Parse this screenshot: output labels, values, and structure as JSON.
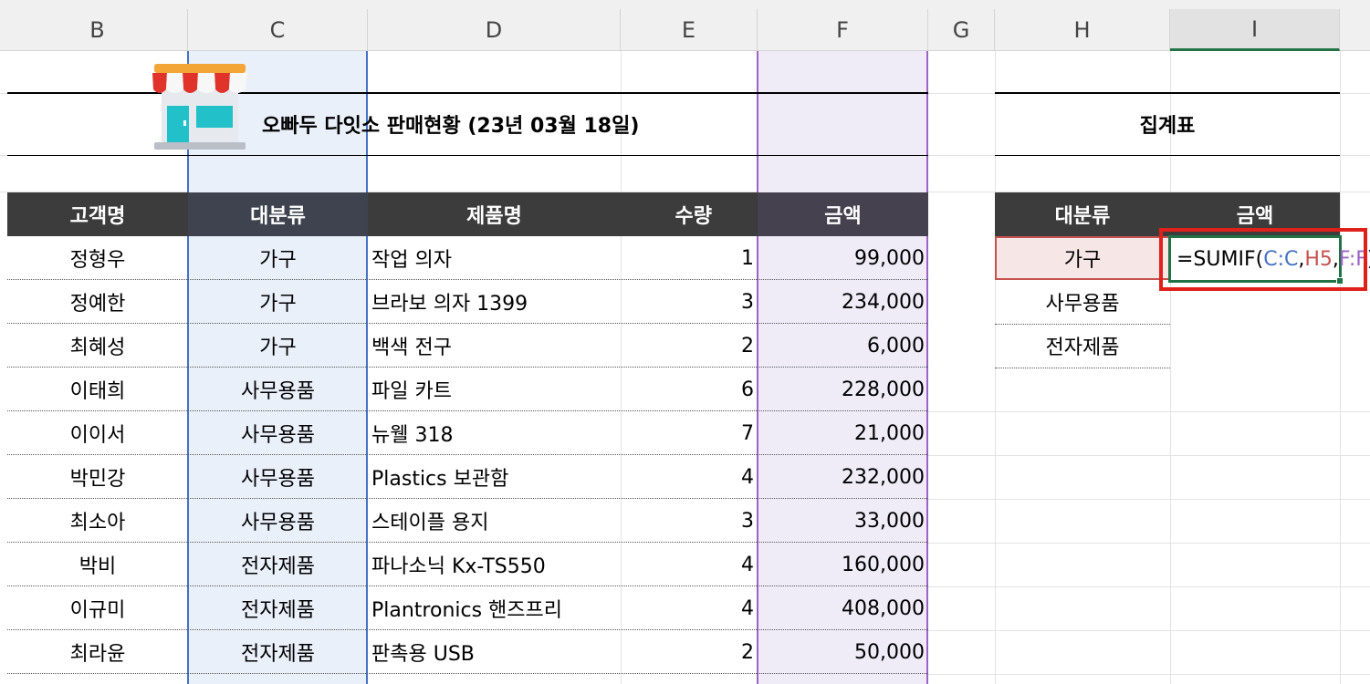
{
  "columns": [
    "B",
    "C",
    "D",
    "E",
    "F",
    "G",
    "H",
    "I"
  ],
  "selected_column": "I",
  "title": "오빠두 다잇소 판매현황 (23년 03월 18일)",
  "summary_title": "집계표",
  "headers": {
    "customer": "고객명",
    "category": "대분류",
    "product": "제품명",
    "qty": "수량",
    "amount": "금액"
  },
  "rows": [
    {
      "customer": "정형우",
      "category": "가구",
      "product": "작업 의자",
      "qty": "1",
      "amount": "99,000"
    },
    {
      "customer": "정예한",
      "category": "가구",
      "product": "브라보 의자 1399",
      "qty": "3",
      "amount": "234,000"
    },
    {
      "customer": "최혜성",
      "category": "가구",
      "product": "백색 전구",
      "qty": "2",
      "amount": "6,000"
    },
    {
      "customer": "이태희",
      "category": "사무용품",
      "product": "파일 카트",
      "qty": "6",
      "amount": "228,000"
    },
    {
      "customer": "이이서",
      "category": "사무용품",
      "product": "뉴웰 318",
      "qty": "7",
      "amount": "21,000"
    },
    {
      "customer": "박민강",
      "category": "사무용품",
      "product": "Plastics 보관함",
      "qty": "4",
      "amount": "232,000"
    },
    {
      "customer": "최소아",
      "category": "사무용품",
      "product": "스테이플 용지",
      "qty": "3",
      "amount": "33,000"
    },
    {
      "customer": "박비",
      "category": "전자제품",
      "product": "파나소닉 Kx-TS550",
      "qty": "4",
      "amount": "160,000"
    },
    {
      "customer": "이규미",
      "category": "전자제품",
      "product": "Plantronics 핸즈프리",
      "qty": "4",
      "amount": "408,000"
    },
    {
      "customer": "최라윤",
      "category": "전자제품",
      "product": "판촉용 USB",
      "qty": "2",
      "amount": "50,000"
    }
  ],
  "summary": {
    "header_category": "대분류",
    "header_amount": "금액",
    "categories": [
      "가구",
      "사무용품",
      "전자제품"
    ]
  },
  "formula": {
    "eq": "=SUMIF(",
    "ref_c": "C:C",
    "sep1": ",",
    "ref_h": "H5",
    "sep2": ",",
    "ref_f": "F:F",
    "close": ")"
  },
  "colors": {
    "header_bg": "#3c3c3c",
    "ref_c": "#4472c4",
    "ref_h": "#c5524f",
    "ref_f": "#9c62c6",
    "active_border": "#217346",
    "callout": "#e0201b"
  },
  "icons": {
    "store": "store-icon"
  }
}
